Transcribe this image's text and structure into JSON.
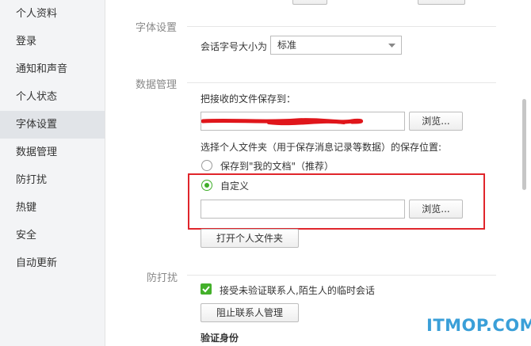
{
  "sidebar": {
    "items": [
      {
        "label": "个人资料"
      },
      {
        "label": "登录"
      },
      {
        "label": "通知和声音"
      },
      {
        "label": "个人状态"
      },
      {
        "label": "字体设置",
        "active": true
      },
      {
        "label": "数据管理"
      },
      {
        "label": "防打扰"
      },
      {
        "label": "热键"
      },
      {
        "label": "安全"
      },
      {
        "label": "自动更新"
      }
    ]
  },
  "font_section": {
    "title": "字体设置",
    "size_label": "会话字号大小为",
    "size_value": "标准"
  },
  "data_section": {
    "title": "数据管理",
    "save_label": "把接收的文件保存到：",
    "browse_label": "浏览...",
    "folder_label": "选择个人文件夹（用于保存消息记录等数据）的保存位置:",
    "option_mydocs": "保存到\"我的文档\"（推荐）",
    "option_custom": "自定义",
    "custom_browse_label": "浏览...",
    "custom_path_value": "",
    "open_folder_label": "打开个人文件夹"
  },
  "dnd_section": {
    "title": "防打扰",
    "accept_temp_label": "接受未验证联系人,陌生人的临时会话",
    "accept_temp_checked": true,
    "block_button_label": "阻止联系人管理",
    "verify_label": "验证身份"
  },
  "watermark": "ITMOP.COM",
  "colors": {
    "accent_green": "#43b02a",
    "highlight_red": "#e0252b",
    "watermark_blue": "#3a9fd8"
  }
}
